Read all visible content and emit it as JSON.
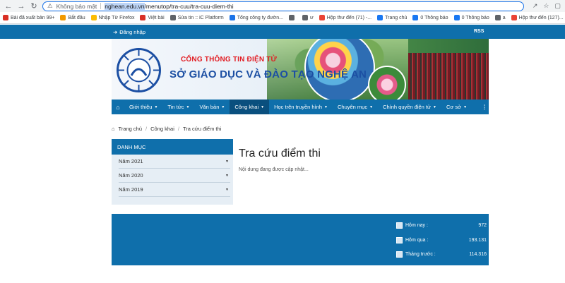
{
  "browser": {
    "security_label": "Không bảo mật",
    "url_selected": "nghean.edu.vn",
    "url_rest": "/menutop/tra-cuu/tra-cuu-diem-thi"
  },
  "bookmarks": [
    {
      "label": "Bài đã xuất bản 99+",
      "color": "#d93025"
    },
    {
      "label": "Bắt đầu",
      "color": "#f29900"
    },
    {
      "label": "Nhập Từ Firefox",
      "color": "#fbbc04"
    },
    {
      "label": "Việt bài",
      "color": "#d93025"
    },
    {
      "label": "Sửa tin :: iC Platform",
      "color": "#5f6368"
    },
    {
      "label": "Tổng công ty đườn...",
      "color": "#1a73e8"
    },
    {
      "label": "",
      "color": "#5f6368"
    },
    {
      "label": "ư",
      "color": "#5f6368"
    },
    {
      "label": "Hộp thư đến (71) -...",
      "color": "#ea4335"
    },
    {
      "label": "Trang chủ",
      "color": "#1877f2"
    },
    {
      "label": "0 Thông báo",
      "color": "#1877f2"
    },
    {
      "label": "0 Thông báo",
      "color": "#1877f2"
    },
    {
      "label": "a",
      "color": "#5f6368"
    },
    {
      "label": "Hộp thư đến (127)...",
      "color": "#ea4335"
    }
  ],
  "topbar": {
    "login": "Đăng nhập",
    "rss": "RSS"
  },
  "banner": {
    "line1": "CỔNG THÔNG TIN ĐIỆN TỬ",
    "line2": "SỞ GIÁO DỤC VÀ ĐÀO TẠO NGHỆ AN"
  },
  "nav": [
    {
      "label": "Giới thiệu",
      "dropdown": true
    },
    {
      "label": "Tin tức",
      "dropdown": true
    },
    {
      "label": "Văn bản",
      "dropdown": true
    },
    {
      "label": "Công khai",
      "dropdown": true,
      "active": true
    },
    {
      "label": "Học trên truyền hình",
      "dropdown": true
    },
    {
      "label": "Chuyên mục",
      "dropdown": true
    },
    {
      "label": "Chính quyền điện tử",
      "dropdown": true
    },
    {
      "label": "Cơ sở",
      "dropdown": true
    }
  ],
  "breadcrumb": [
    "Trang chủ",
    "Công khai",
    "Tra cứu điểm thi"
  ],
  "sidebar": {
    "title": "DANH MỤC",
    "items": [
      "Năm 2021",
      "Năm 2020",
      "Năm 2019"
    ]
  },
  "content": {
    "title": "Tra cứu điểm thi",
    "note": "Nội dung đang được cập nhật..."
  },
  "stats": [
    {
      "label": "Hôm nay :",
      "value": "972"
    },
    {
      "label": "Hôm qua :",
      "value": "193.131"
    },
    {
      "label": "Tháng trước :",
      "value": "114.316"
    }
  ],
  "colors": {
    "primary": "#0f6fab",
    "active_nav": "#0a4f7e",
    "banner_red": "#e21c22",
    "banner_blue": "#1c4fa3"
  }
}
